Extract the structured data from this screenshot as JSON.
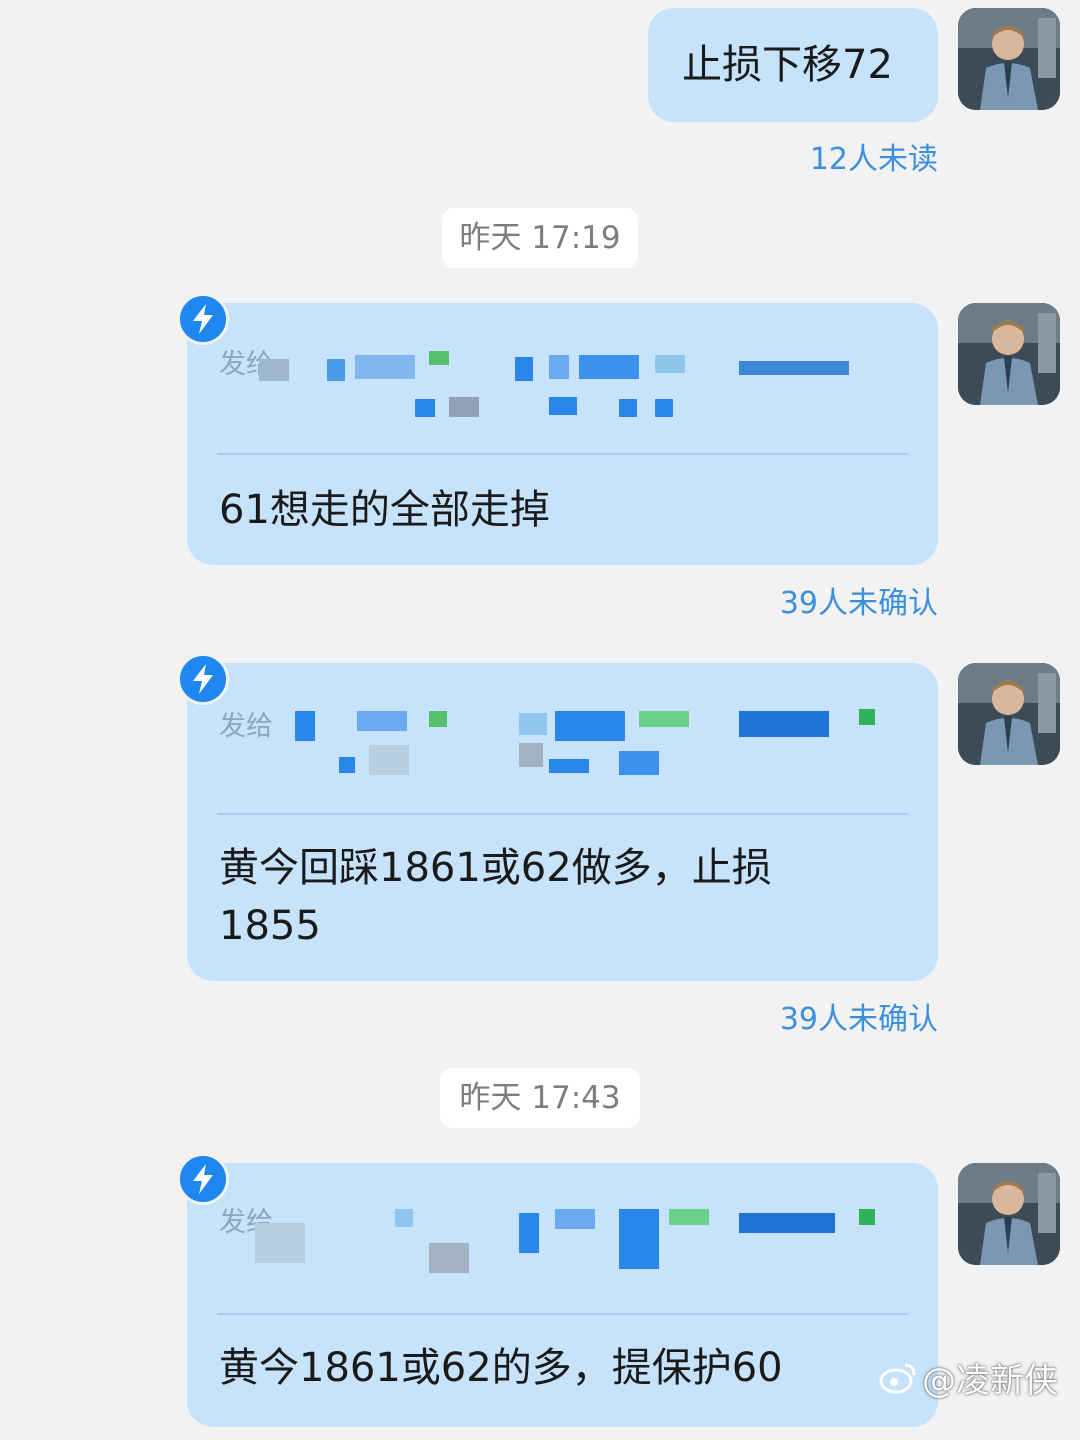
{
  "messages": [
    {
      "text": "止损下移72",
      "status": "12人未读"
    },
    {
      "timestamp": "昨天 17:19"
    },
    {
      "recipients_prefix": "发给",
      "text": "61想走的全部走掉",
      "status": "39人未确认"
    },
    {
      "recipients_prefix": "发给",
      "text": "黄今回踩1861或62做多，止损1855",
      "status": "39人未确认"
    },
    {
      "timestamp": "昨天 17:43"
    },
    {
      "recipients_prefix": "发给",
      "text": "黄今1861或62的多，提保护60"
    }
  ],
  "watermark": "@凌新侠",
  "icons": {
    "urgent": "lightning-bolt-icon",
    "avatar": "user-avatar",
    "watermark": "weibo-logo-icon"
  },
  "colors": {
    "bubble": "#c7e3fb",
    "accent": "#1e88f0",
    "status": "#3b8fe0",
    "background": "#f2f2f2"
  }
}
